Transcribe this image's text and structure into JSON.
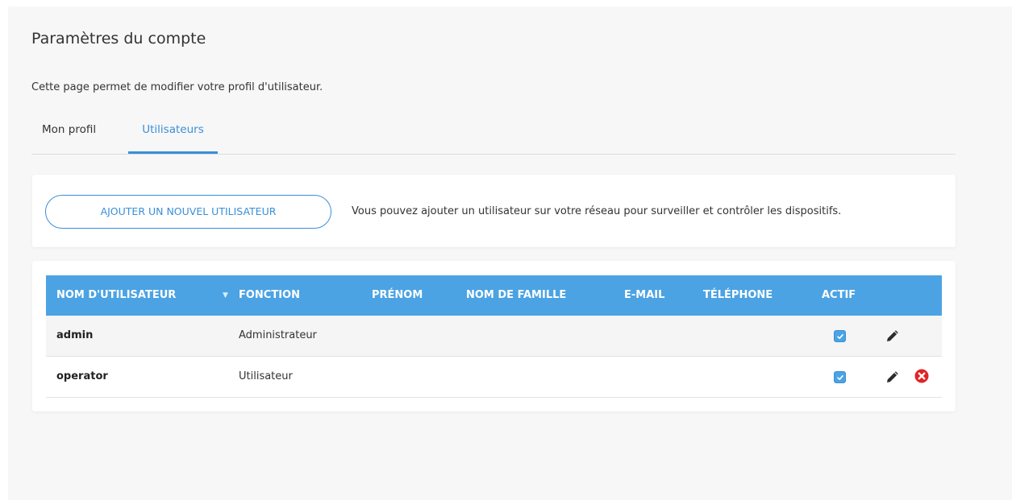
{
  "page": {
    "title": "Paramètres du compte",
    "description": "Cette page permet de modifier votre profil d'utilisateur."
  },
  "tabs": [
    {
      "label": "Mon profil",
      "active": false
    },
    {
      "label": "Utilisateurs",
      "active": true
    }
  ],
  "add_user": {
    "button_label": "AJOUTER UN NOUVEL UTILISATEUR",
    "text": "Vous pouvez ajouter un utilisateur sur votre réseau pour surveiller et contrôler les dispositifs."
  },
  "table": {
    "columns": {
      "username": "NOM D'UTILISATEUR",
      "function": "FONCTION",
      "firstname": "PRÉNOM",
      "lastname": "NOM DE FAMILLE",
      "email": "E-MAIL",
      "phone": "TÉLÉPHONE",
      "active": "ACTIF"
    },
    "sort_indicator": "▼",
    "rows": [
      {
        "username": "admin",
        "function": "Administrateur",
        "firstname": "",
        "lastname": "",
        "email": "",
        "phone": "",
        "active": true,
        "editable": true,
        "deletable": false
      },
      {
        "username": "operator",
        "function": "Utilisateur",
        "firstname": "",
        "lastname": "",
        "email": "",
        "phone": "",
        "active": true,
        "editable": true,
        "deletable": true
      }
    ]
  },
  "icons": {
    "edit": "pencil-icon",
    "delete": "delete-circle-icon",
    "checkbox": "checkbox-checked-icon",
    "sort": "sort-down-icon"
  },
  "colors": {
    "accent": "#3a8fd9",
    "table_header": "#4ba3e3",
    "delete": "#e02424",
    "background": "#f7f7f7"
  }
}
